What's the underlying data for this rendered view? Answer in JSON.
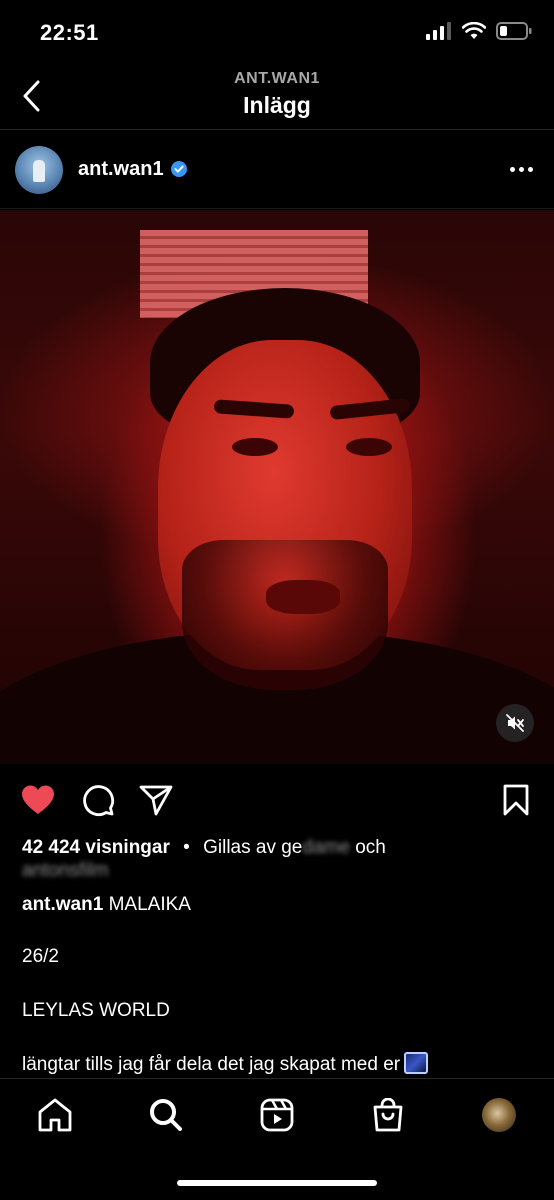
{
  "status": {
    "time": "22:51"
  },
  "header": {
    "account": "ANT.WAN1",
    "title": "Inlägg"
  },
  "post": {
    "username": "ant.wan1",
    "verified": true,
    "views": "42 424 visningar",
    "separator": "•",
    "liked_by_prefix": "Gillas av ge",
    "liked_by_blur1": "dame",
    "liked_by_suffix": "och",
    "liked_by_line2": "antonsfilm",
    "caption_title": "MALAIKA",
    "caption_lines": [
      "26/2",
      "LEYLAS WORLD",
      "längtar tills jag får dela det jag skapat med er"
    ],
    "liked": true,
    "muted": true
  },
  "icons": {
    "back": "chevron-left-icon",
    "more": "more-dots-icon",
    "like": "heart-icon",
    "comment": "comment-icon",
    "share": "send-icon",
    "save": "bookmark-icon",
    "mute": "speaker-muted-icon"
  },
  "tabs": [
    "home",
    "search",
    "reels",
    "shop",
    "profile"
  ],
  "colors": {
    "like": "#ed4956",
    "verified": "#3897f0",
    "secondary_text": "#a8a8a8"
  }
}
